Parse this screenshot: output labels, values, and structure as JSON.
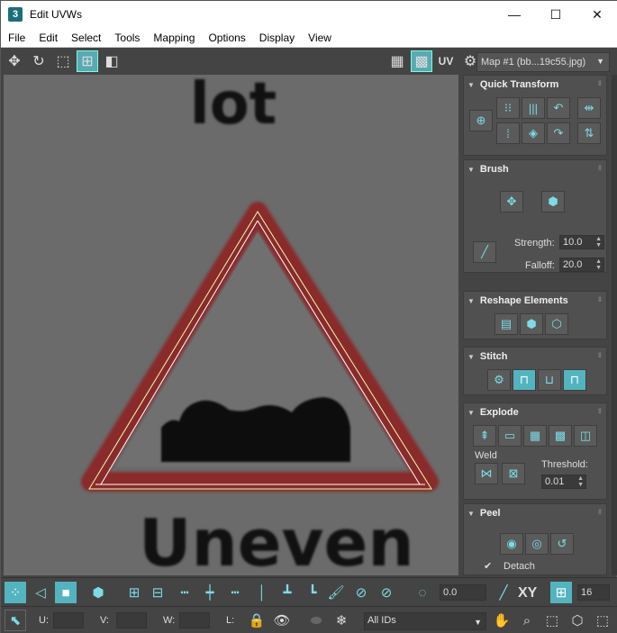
{
  "window": {
    "title": "Edit UVWs",
    "app_icon": "3",
    "min": "—",
    "max": "☐",
    "close": "✕"
  },
  "menu": [
    "File",
    "Edit",
    "Select",
    "Tools",
    "Mapping",
    "Options",
    "Display",
    "View"
  ],
  "toolbar": {
    "uv_label": "UV",
    "map_select": "Map #1 (bb...19c55.jpg)"
  },
  "viewport": {
    "texture_text_top": "lot",
    "texture_text_bottom": "Uneven"
  },
  "rollouts": {
    "quick_transform": "Quick Transform",
    "brush": "Brush",
    "strength_label": "Strength:",
    "strength_value": "10.0",
    "falloff_label": "Falloff:",
    "falloff_value": "20.0",
    "reshape": "Reshape Elements",
    "stitch": "Stitch",
    "explode": "Explode",
    "weld_label": "Weld",
    "threshold_label": "Threshold:",
    "threshold_value": "0.01",
    "peel": "Peel",
    "detach_label": "Detach",
    "detach_checked": true
  },
  "bottom": {
    "angle_value": "0.0",
    "xy_label": "XY",
    "grid_value": "16",
    "u_label": "U:",
    "v_label": "V:",
    "w_label": "W:",
    "l_label": "L:",
    "ids_select": "All IDs"
  },
  "colors": {
    "accent": "#53b4bf",
    "viewport_bg": "#6b6b6b",
    "sign_red": "#b03030"
  }
}
